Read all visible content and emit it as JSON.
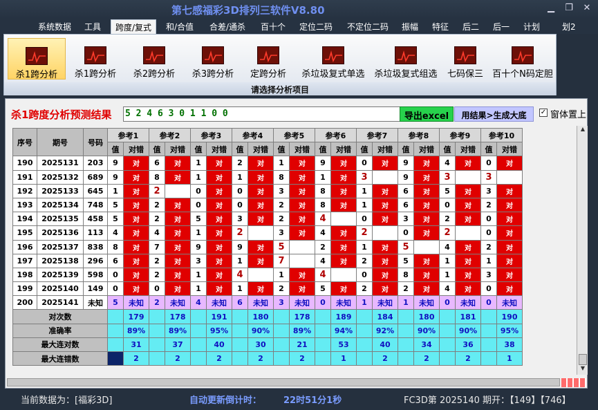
{
  "app": {
    "title": "第七感福彩3D排列三软件V8.80",
    "controls": [
      "▁",
      "❐",
      "✕"
    ]
  },
  "menu": [
    "系统数据",
    "工具",
    "跨度/复式",
    "和/合值",
    "合差/通杀",
    "百十个",
    "定位二码",
    "不定位二码",
    "振幅",
    "特征",
    "后二",
    "后一",
    "计划",
    "划2"
  ],
  "menu_active": 2,
  "ribbon": {
    "buttons": [
      "杀1跨分析",
      "杀1跨分析",
      "杀2跨分析",
      "杀3跨分析",
      "定跨分析",
      "杀垃圾复式单选",
      "杀垃圾复式组选",
      "七码保三",
      "百十个N码定胆"
    ],
    "selected": 0,
    "caption": "请选择分析项目"
  },
  "result": {
    "label": "杀1跨度分析预测结果",
    "value": "5 2 4 6 3 0 1 1 0 0",
    "excel_button": "导出excel",
    "gen_button": "用结果>生成大底",
    "pin_checkbox_label": "窗体置上",
    "pin_checked": true
  },
  "table": {
    "headers": {
      "seq": "序号",
      "issue": "期号",
      "number": "号码",
      "ref_names": [
        "参考1",
        "参考2",
        "参考3",
        "参考4",
        "参考5",
        "参考6",
        "参考7",
        "参考8",
        "参考9",
        "参考10"
      ],
      "val": "值",
      "hit": "对错"
    },
    "hit_text": "对",
    "rows": [
      {
        "seq": "190",
        "issue": "2025131",
        "num": "203",
        "cells": [
          [
            "9",
            "对"
          ],
          [
            "6",
            "对"
          ],
          [
            "1",
            "对"
          ],
          [
            "2",
            "对"
          ],
          [
            "1",
            "对"
          ],
          [
            "9",
            "对"
          ],
          [
            "0",
            "对"
          ],
          [
            "9",
            "对"
          ],
          [
            "4",
            "对"
          ],
          [
            "0",
            "对"
          ]
        ]
      },
      {
        "seq": "191",
        "issue": "2025132",
        "num": "689",
        "cells": [
          [
            "9",
            "对"
          ],
          [
            "8",
            "对"
          ],
          [
            "1",
            "对"
          ],
          [
            "1",
            "对"
          ],
          [
            "8",
            "对"
          ],
          [
            "1",
            "对"
          ],
          [
            "3",
            ""
          ],
          [
            "9",
            "对"
          ],
          [
            "3",
            ""
          ],
          [
            "3",
            ""
          ]
        ]
      },
      {
        "seq": "192",
        "issue": "2025133",
        "num": "645",
        "cells": [
          [
            "1",
            "对"
          ],
          [
            "2",
            ""
          ],
          [
            "0",
            "对"
          ],
          [
            "0",
            "对"
          ],
          [
            "3",
            "对"
          ],
          [
            "8",
            "对"
          ],
          [
            "1",
            "对"
          ],
          [
            "6",
            "对"
          ],
          [
            "5",
            "对"
          ],
          [
            "3",
            "对"
          ]
        ]
      },
      {
        "seq": "193",
        "issue": "2025134",
        "num": "748",
        "cells": [
          [
            "5",
            "对"
          ],
          [
            "2",
            "对"
          ],
          [
            "0",
            "对"
          ],
          [
            "0",
            "对"
          ],
          [
            "2",
            "对"
          ],
          [
            "8",
            "对"
          ],
          [
            "1",
            "对"
          ],
          [
            "6",
            "对"
          ],
          [
            "0",
            "对"
          ],
          [
            "2",
            "对"
          ]
        ]
      },
      {
        "seq": "194",
        "issue": "2025135",
        "num": "458",
        "cells": [
          [
            "5",
            "对"
          ],
          [
            "2",
            "对"
          ],
          [
            "5",
            "对"
          ],
          [
            "3",
            "对"
          ],
          [
            "2",
            "对"
          ],
          [
            "4",
            ""
          ],
          [
            "0",
            "对"
          ],
          [
            "3",
            "对"
          ],
          [
            "2",
            "对"
          ],
          [
            "0",
            "对"
          ]
        ]
      },
      {
        "seq": "195",
        "issue": "2025136",
        "num": "113",
        "cells": [
          [
            "4",
            "对"
          ],
          [
            "4",
            "对"
          ],
          [
            "1",
            "对"
          ],
          [
            "2",
            ""
          ],
          [
            "3",
            "对"
          ],
          [
            "4",
            "对"
          ],
          [
            "2",
            ""
          ],
          [
            "0",
            "对"
          ],
          [
            "2",
            ""
          ],
          [
            "0",
            "对"
          ]
        ]
      },
      {
        "seq": "196",
        "issue": "2025137",
        "num": "838",
        "cells": [
          [
            "8",
            "对"
          ],
          [
            "7",
            "对"
          ],
          [
            "9",
            "对"
          ],
          [
            "9",
            "对"
          ],
          [
            "5",
            ""
          ],
          [
            "2",
            "对"
          ],
          [
            "1",
            "对"
          ],
          [
            "5",
            ""
          ],
          [
            "4",
            "对"
          ],
          [
            "2",
            "对"
          ]
        ]
      },
      {
        "seq": "197",
        "issue": "2025138",
        "num": "296",
        "cells": [
          [
            "6",
            "对"
          ],
          [
            "2",
            "对"
          ],
          [
            "3",
            "对"
          ],
          [
            "1",
            "对"
          ],
          [
            "7",
            ""
          ],
          [
            "4",
            "对"
          ],
          [
            "2",
            "对"
          ],
          [
            "5",
            "对"
          ],
          [
            "1",
            "对"
          ],
          [
            "1",
            "对"
          ]
        ]
      },
      {
        "seq": "198",
        "issue": "2025139",
        "num": "598",
        "cells": [
          [
            "0",
            "对"
          ],
          [
            "2",
            "对"
          ],
          [
            "1",
            "对"
          ],
          [
            "4",
            ""
          ],
          [
            "1",
            "对"
          ],
          [
            "4",
            ""
          ],
          [
            "0",
            "对"
          ],
          [
            "8",
            "对"
          ],
          [
            "1",
            "对"
          ],
          [
            "3",
            "对"
          ]
        ]
      },
      {
        "seq": "199",
        "issue": "2025140",
        "num": "149",
        "cells": [
          [
            "0",
            "对"
          ],
          [
            "0",
            "对"
          ],
          [
            "1",
            "对"
          ],
          [
            "1",
            "对"
          ],
          [
            "2",
            "对"
          ],
          [
            "5",
            "对"
          ],
          [
            "2",
            "对"
          ],
          [
            "2",
            "对"
          ],
          [
            "4",
            "对"
          ],
          [
            "0",
            "对"
          ]
        ]
      },
      {
        "seq": "200",
        "issue": "2025141",
        "num": "未知",
        "cells": [
          [
            "5",
            "未知"
          ],
          [
            "2",
            "未知"
          ],
          [
            "4",
            "未知"
          ],
          [
            "6",
            "未知"
          ],
          [
            "3",
            "未知"
          ],
          [
            "0",
            "未知"
          ],
          [
            "1",
            "未知"
          ],
          [
            "1",
            "未知"
          ],
          [
            "0",
            "未知"
          ],
          [
            "0",
            "未知"
          ]
        ]
      }
    ],
    "highlight_rows": [
      [],
      [
        6,
        8,
        9
      ],
      [
        1
      ],
      [],
      [
        5
      ],
      [
        3,
        6,
        8
      ],
      [
        4,
        7
      ],
      [
        4
      ],
      [
        3,
        5
      ],
      [],
      []
    ],
    "stats": [
      {
        "label": "对次数",
        "values": [
          "179",
          "178",
          "191",
          "180",
          "178",
          "189",
          "184",
          "180",
          "181",
          "190"
        ]
      },
      {
        "label": "准确率",
        "values": [
          "89%",
          "89%",
          "95%",
          "90%",
          "89%",
          "94%",
          "92%",
          "90%",
          "90%",
          "95%"
        ]
      },
      {
        "label": "最大连对数",
        "values": [
          "31",
          "37",
          "40",
          "30",
          "21",
          "53",
          "40",
          "34",
          "36",
          "38"
        ]
      },
      {
        "label": "最大连错数",
        "values": [
          "2",
          "2",
          "2",
          "2",
          "2",
          "1",
          "2",
          "2",
          "2",
          "1"
        ]
      }
    ]
  },
  "status": {
    "current": "当前数据为：[福彩3D]",
    "countdown_label": "自动更新倒计时：",
    "countdown": "22时51分1秒",
    "issue_info": "FC3D第 2025140 期开：【149】【746】"
  },
  "colors": {
    "hit_red": "#e00000",
    "unknown_purple": "#e8b8ff",
    "stats_cyan": "#64ecf3",
    "excel_green": "#27d24c",
    "title_blue": "#6f8ff0"
  }
}
